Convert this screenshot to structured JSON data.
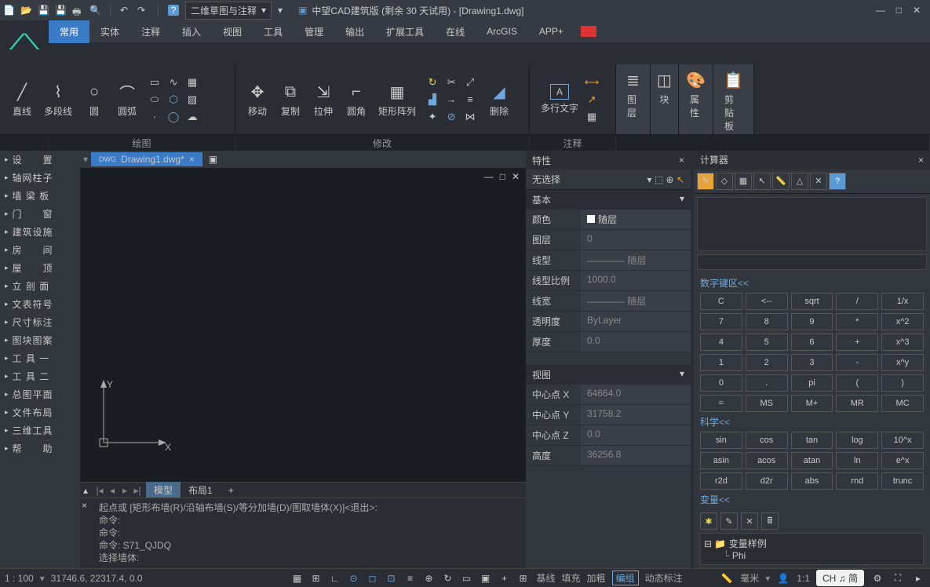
{
  "title": {
    "app": "中望CAD建筑版 (剩余 30 天试用) - [Drawing1.dwg]",
    "workspace": "二维草图与注释"
  },
  "menu": {
    "tabs": [
      "常用",
      "实体",
      "注释",
      "插入",
      "视图",
      "工具",
      "管理",
      "输出",
      "扩展工具",
      "在线",
      "ArcGIS",
      "APP+"
    ]
  },
  "ribbon": {
    "draw": {
      "label": "绘图",
      "items": [
        "直线",
        "多段线",
        "圆",
        "圆弧"
      ]
    },
    "modify": {
      "label": "修改",
      "items": [
        "移动",
        "复制",
        "拉伸",
        "圆角",
        "矩形阵列",
        "删除"
      ]
    },
    "annot": {
      "label": "注释",
      "items": [
        "多行文字"
      ]
    },
    "layer": {
      "label": "图层"
    },
    "block": {
      "label": "块"
    },
    "attr": {
      "label": "属性"
    },
    "clip": {
      "label": "剪贴板"
    }
  },
  "leftPanel": {
    "items": [
      "设　　置",
      "轴网柱子",
      "墙 梁 板",
      "门　　窗",
      "建筑设施",
      "房　　间",
      "屋　　顶",
      "立 剖 面",
      "文表符号",
      "尺寸标注",
      "图块图案",
      "工 具 一",
      "工 具 二",
      "总图平面",
      "文件布局",
      "三维工具",
      "帮　　助"
    ]
  },
  "doc": {
    "tab": "Drawing1.dwg*"
  },
  "modelTabs": {
    "model": "模型",
    "layout": "布局1"
  },
  "cmd": {
    "l1": "起点或 [矩形布墙(R)/沿轴布墙(S)/等分加墙(D)/图取墙体(X)]<退出>:",
    "l2": "命令:",
    "l3": "命令:",
    "l4": "命令: S71_QJDQ",
    "l5": "选择墙体:"
  },
  "props": {
    "title": "特性",
    "noSelect": "无选择",
    "sections": {
      "basic": "基本",
      "view": "视图"
    },
    "rows": {
      "color": {
        "k": "颜色",
        "v": "随层"
      },
      "layer": {
        "k": "图层",
        "v": "0"
      },
      "linetype": {
        "k": "线型",
        "v": "———— 随层"
      },
      "ltscale": {
        "k": "线型比例",
        "v": "1000.0"
      },
      "lweight": {
        "k": "线宽",
        "v": "———— 随层"
      },
      "transp": {
        "k": "透明度",
        "v": "ByLayer"
      },
      "thick": {
        "k": "厚度",
        "v": "0.0"
      },
      "cx": {
        "k": "中心点 X",
        "v": "64664.0"
      },
      "cy": {
        "k": "中心点 Y",
        "v": "31758.2"
      },
      "cz": {
        "k": "中心点 Z",
        "v": "0.0"
      },
      "height": {
        "k": "高度",
        "v": "36256.8"
      }
    }
  },
  "calc": {
    "title": "计算器",
    "numpad_h": "数字键区<<",
    "sci_h": "科学<<",
    "var_h": "变量<<",
    "var_sample": "变量样例",
    "var_phi": "Phi",
    "buttons": {
      "r1": [
        "C",
        "<--",
        "sqrt",
        "/",
        "1/x"
      ],
      "r2": [
        "7",
        "8",
        "9",
        "*",
        "x^2"
      ],
      "r3": [
        "4",
        "5",
        "6",
        "+",
        "x^3"
      ],
      "r4": [
        "1",
        "2",
        "3",
        "-",
        "x^y"
      ],
      "r5": [
        "0",
        ".",
        "pi",
        "(",
        ")"
      ],
      "r6": [
        "=",
        "MS",
        "M+",
        "MR",
        "MC"
      ],
      "s1": [
        "sin",
        "cos",
        "tan",
        "log",
        "10^x"
      ],
      "s2": [
        "asin",
        "acos",
        "atan",
        "ln",
        "e^x"
      ],
      "s3": [
        "r2d",
        "d2r",
        "abs",
        "rnd",
        "trunc"
      ]
    }
  },
  "status": {
    "scale": "1 : 100",
    "coords": "31746.6, 22317.4, 0.0",
    "t_baseline": "基线",
    "t_fill": "填充",
    "t_add": "加粗",
    "t_group": "编组",
    "t_dyn": "动态标注",
    "unit": "毫米",
    "ratio": "1:1",
    "ime": "CH ♫ 简"
  }
}
